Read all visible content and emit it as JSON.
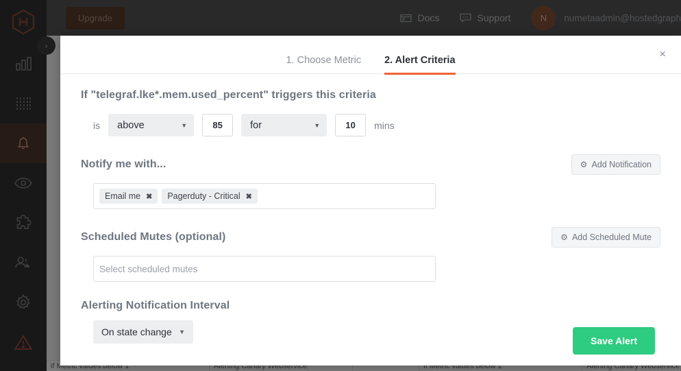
{
  "sidebar": {
    "logo_name": "hostedgraphite-logo",
    "items": [
      {
        "name": "dashboards",
        "icon": "bar-chart-icon",
        "active": false
      },
      {
        "name": "metrics",
        "icon": "metrics-grid-icon",
        "active": false
      },
      {
        "name": "alerts",
        "icon": "bell-icon",
        "active": true
      },
      {
        "name": "monitoring",
        "icon": "eye-icon",
        "active": false
      },
      {
        "name": "integrations",
        "icon": "puzzle-icon",
        "active": false
      },
      {
        "name": "team",
        "icon": "users-icon",
        "active": false
      },
      {
        "name": "settings",
        "icon": "gear-icon",
        "active": false
      },
      {
        "name": "incidents",
        "icon": "warning-triangle-icon",
        "active": false
      }
    ]
  },
  "topbar": {
    "upgrade_label": "Upgrade",
    "docs_label": "Docs",
    "support_label": "Support",
    "avatar_initial": "N",
    "user_email": "numetaadmin@hostedgraph"
  },
  "background_table": {
    "rows": [
      {
        "condition": "if  Metric values below 1",
        "name": "Alerting Canary Webservice",
        "col3": "",
        "col4": ""
      },
      {
        "condition": "if  Metric values below 1",
        "name": "Alerting Canary Webservice",
        "col3": "",
        "col4": ""
      }
    ]
  },
  "modal": {
    "close_label": "×",
    "tabs": [
      {
        "label": "1. Choose Metric",
        "active": false
      },
      {
        "label": "2. Alert Criteria",
        "active": true
      }
    ],
    "criteria": {
      "title": "If \"telegraf.lke*.mem.used_percent\" triggers this criteria",
      "is_label": "is",
      "comparator": "above",
      "threshold": "85",
      "duration_label": "for",
      "duration_value": "10",
      "duration_unit": "mins"
    },
    "notify": {
      "title": "Notify me with...",
      "add_button_label": "Add Notification",
      "chips": [
        {
          "label": "Email me",
          "remove": "✖"
        },
        {
          "label": "Pagerduty - Critical",
          "remove": "✖"
        }
      ]
    },
    "mutes": {
      "title": "Scheduled Mutes (optional)",
      "add_button_label": "Add Scheduled Mute",
      "placeholder": "Select scheduled mutes",
      "value": ""
    },
    "interval": {
      "title": "Alerting Notification Interval",
      "selected": "On state change"
    },
    "save_label": "Save Alert"
  },
  "colors": {
    "accent_orange": "#ef6437",
    "save_green": "#2ecc80",
    "sidebar_dark": "#1d1e1f",
    "topbar_gray": "#434446",
    "active_nav": "#3d2417"
  }
}
